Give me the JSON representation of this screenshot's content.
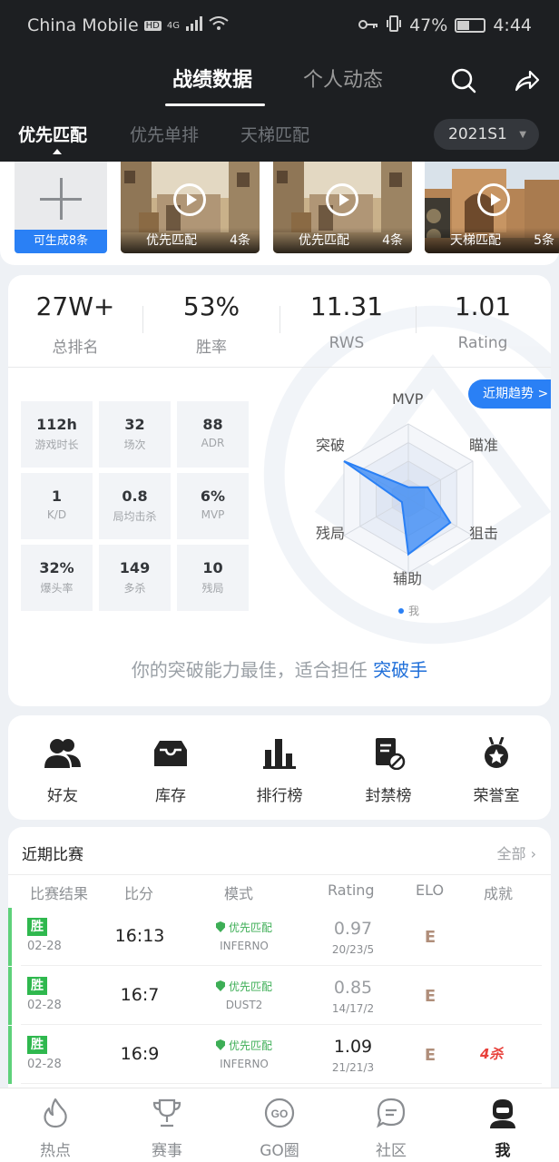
{
  "status_bar": {
    "carrier": "China Mobile",
    "network_badges": [
      "HD",
      "4G"
    ],
    "battery_percent": "47%",
    "battery_level": 0.47,
    "time": "4:44",
    "icons": [
      "signal-icon",
      "wifi-icon",
      "key-icon",
      "vibrate-icon",
      "battery-icon"
    ]
  },
  "header": {
    "tabs": [
      {
        "label": "战绩数据",
        "active": true
      },
      {
        "label": "个人动态",
        "active": false
      }
    ],
    "icons": [
      "search-icon",
      "share-icon"
    ]
  },
  "sub_tabs": [
    {
      "label": "优先匹配",
      "active": true
    },
    {
      "label": "优先单排",
      "active": false
    },
    {
      "label": "天梯匹配",
      "active": false
    }
  ],
  "season_select": {
    "value": "2021S1"
  },
  "videos": {
    "add_label": "可生成8条",
    "cards": [
      {
        "mode": "优先匹配",
        "count": "4条",
        "scene": "dust"
      },
      {
        "mode": "优先匹配",
        "count": "4条",
        "scene": "dust"
      },
      {
        "mode": "天梯匹配",
        "count": "5条",
        "scene": "inferno"
      }
    ]
  },
  "summary_stats": [
    {
      "value": "27W+",
      "label": "总排名"
    },
    {
      "value": "53%",
      "label": "胜率"
    },
    {
      "value": "11.31",
      "label": "RWS"
    },
    {
      "value": "1.01",
      "label": "Rating"
    }
  ],
  "detail_stats": [
    {
      "value": "112h",
      "label": "游戏时长"
    },
    {
      "value": "32",
      "label": "场次"
    },
    {
      "value": "88",
      "label": "ADR"
    },
    {
      "value": "1",
      "label": "K/D"
    },
    {
      "value": "0.8",
      "label": "局均击杀"
    },
    {
      "value": "6%",
      "label": "MVP"
    },
    {
      "value": "32%",
      "label": "爆头率"
    },
    {
      "value": "149",
      "label": "多杀"
    },
    {
      "value": "10",
      "label": "残局"
    }
  ],
  "trend_button": "近期趋势 >",
  "radar": {
    "axes": [
      "MVP",
      "瞄准",
      "狙击",
      "辅助",
      "残局",
      "突破"
    ],
    "values": [
      0.15,
      0.3,
      0.65,
      0.75,
      0.1,
      1.0
    ],
    "legend": "我",
    "color": "#2a80f5"
  },
  "ability_summary": {
    "text": "你的突破能力最佳，适合担任",
    "role": "突破手"
  },
  "tools": [
    {
      "label": "好友",
      "icon": "friends-icon"
    },
    {
      "label": "库存",
      "icon": "inventory-icon"
    },
    {
      "label": "排行榜",
      "icon": "leaderboard-icon"
    },
    {
      "label": "封禁榜",
      "icon": "ban-list-icon"
    },
    {
      "label": "荣誉室",
      "icon": "honor-room-icon"
    }
  ],
  "recent_matches": {
    "title": "近期比赛",
    "all_link": "全部",
    "columns": [
      "比赛结果",
      "比分",
      "模式",
      "Rating",
      "ELO",
      "成就"
    ],
    "rows": [
      {
        "result": "胜",
        "date": "02-28",
        "score": "16:13",
        "mode": "优先匹配",
        "map": "INFERNO",
        "rating": "0.97",
        "kda": "20/23/5",
        "elo": "E",
        "achievement": ""
      },
      {
        "result": "胜",
        "date": "02-28",
        "score": "16:7",
        "mode": "优先匹配",
        "map": "DUST2",
        "rating": "0.85",
        "kda": "14/17/2",
        "elo": "E",
        "achievement": ""
      },
      {
        "result": "胜",
        "date": "02-28",
        "score": "16:9",
        "mode": "优先匹配",
        "map": "INFERNO",
        "rating": "1.09",
        "kda": "21/21/3",
        "elo": "E",
        "achievement": "4杀"
      }
    ]
  },
  "bottom_nav": [
    {
      "label": "热点",
      "icon": "flame-icon",
      "active": false
    },
    {
      "label": "赛事",
      "icon": "trophy-icon",
      "active": false
    },
    {
      "label": "GO圈",
      "icon": "go-circle-icon",
      "active": false
    },
    {
      "label": "社区",
      "icon": "chat-icon",
      "active": false
    },
    {
      "label": "我",
      "icon": "profile-icon",
      "active": true
    }
  ]
}
